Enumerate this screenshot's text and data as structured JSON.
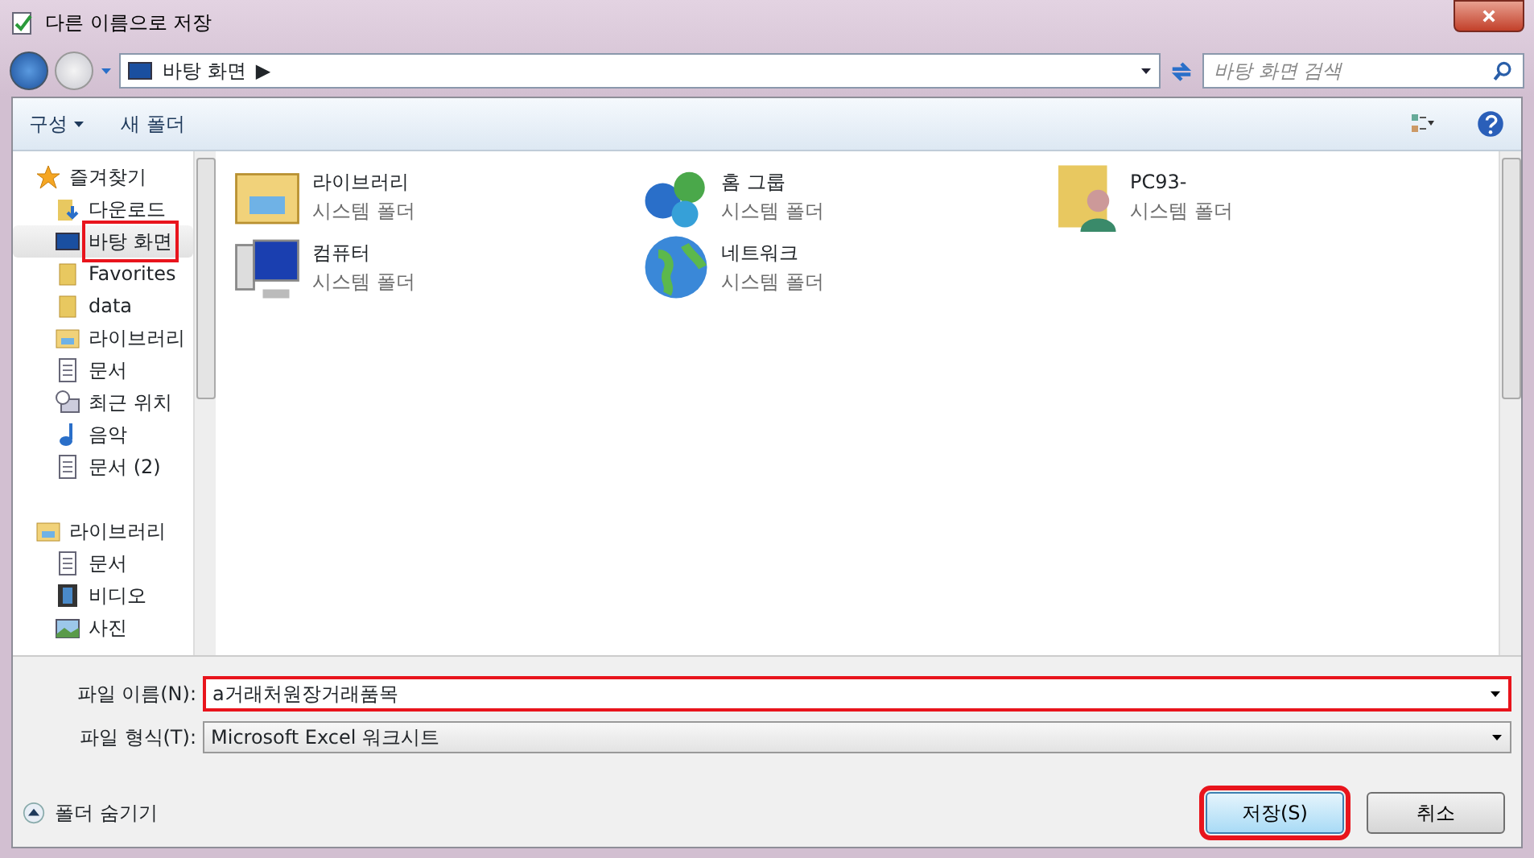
{
  "window": {
    "title": "다른 이름으로 저장"
  },
  "address_bar": {
    "location": "바탕 화면",
    "separator": "▶"
  },
  "search": {
    "placeholder": "바탕 화면 검색"
  },
  "toolbar": {
    "buttons": [
      "구성",
      "새 폴더"
    ]
  },
  "sidebar": {
    "items": [
      {
        "label": "즐겨찾기",
        "kind": "star",
        "selected": false,
        "annotated": false,
        "children": [
          {
            "label": "다운로드",
            "kind": "download",
            "selected": false,
            "annotated": false
          },
          {
            "label": "바탕 화면",
            "kind": "desktop",
            "selected": true,
            "annotated": true
          },
          {
            "label": "Favorites",
            "kind": "folder",
            "selected": false,
            "annotated": false
          },
          {
            "label": "data",
            "kind": "folder",
            "selected": false,
            "annotated": false
          },
          {
            "label": "라이브러리",
            "kind": "library",
            "selected": false,
            "annotated": false
          },
          {
            "label": "문서",
            "kind": "document",
            "selected": false,
            "annotated": false
          },
          {
            "label": "최근 위치",
            "kind": "recent",
            "selected": false,
            "annotated": false
          },
          {
            "label": "음악",
            "kind": "music",
            "selected": false,
            "annotated": false
          },
          {
            "label": "문서 (2)",
            "kind": "document",
            "selected": false,
            "annotated": false
          }
        ]
      },
      {
        "label": "라이브러리",
        "kind": "library",
        "selected": false,
        "annotated": false,
        "children": [
          {
            "label": "문서",
            "kind": "document",
            "selected": false,
            "annotated": false
          },
          {
            "label": "비디오",
            "kind": "video",
            "selected": false,
            "annotated": false
          },
          {
            "label": "사진",
            "kind": "picture",
            "selected": false,
            "annotated": false
          }
        ]
      }
    ]
  },
  "files": [
    {
      "name": "라이브러리",
      "type": "시스템 폴더",
      "kind": "library"
    },
    {
      "name": "홈 그룹",
      "type": "시스템 폴더",
      "kind": "homegroup"
    },
    {
      "name": "PC93-",
      "type": "시스템 폴더",
      "kind": "user"
    },
    {
      "name": "컴퓨터",
      "type": "시스템 폴더",
      "kind": "computer"
    },
    {
      "name": "네트워크",
      "type": "시스템 폴더",
      "kind": "network"
    }
  ],
  "form": {
    "file_name": {
      "label": "파일 이름(N):",
      "value": "a거래처원장거래품목",
      "annotated": true
    },
    "file_type": {
      "label": "파일 형식(T):",
      "value": "Microsoft Excel 워크시트"
    }
  },
  "hide_folders": {
    "label": "폴더 숨기기"
  },
  "buttons": [
    {
      "label": "저장(S)",
      "kind": "primary",
      "annotated": true
    },
    {
      "label": "취소",
      "kind": "normal",
      "annotated": false
    }
  ]
}
